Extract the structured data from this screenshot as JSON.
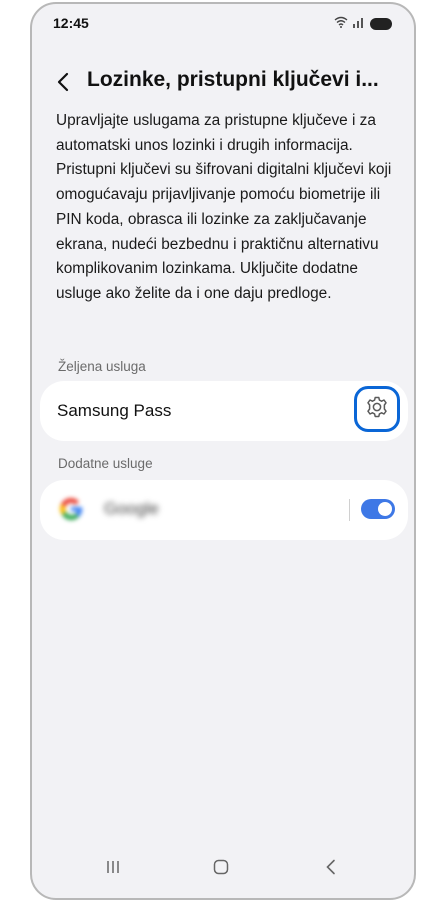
{
  "status_bar": {
    "time": "12:45"
  },
  "header": {
    "title": "Lozinke, pristupni ključevi i..."
  },
  "description": "Upravljajte uslugama za pristupne ključeve i za automatski unos lozinki i drugih informacija. Pristupni ključevi su šifrovani digitalni ključevi koji omogućavaju prijavljivanje pomoću biometrije ili PIN koda, obrasca ili lozinke za zaključavanje ekrana, nudeći bezbednu i praktičnu alternativu komplikovanim lozinkama. Uključite dodatne usluge ako želite da i one daju predloge.",
  "preferred_service": {
    "section_label": "Željena usluga",
    "name": "Samsung Pass",
    "settings_icon": "gear-icon"
  },
  "additional_services": {
    "section_label": "Dodatne usluge",
    "items": [
      {
        "name": "Google",
        "icon": "google-logo",
        "enabled": true
      }
    ]
  },
  "colors": {
    "background": "#f2f2f5",
    "card": "#ffffff",
    "accent": "#3e78e6",
    "highlight_border": "#0a66d6"
  },
  "nav_bar": {
    "icons": [
      "recents-icon",
      "home-icon",
      "back-icon"
    ]
  }
}
